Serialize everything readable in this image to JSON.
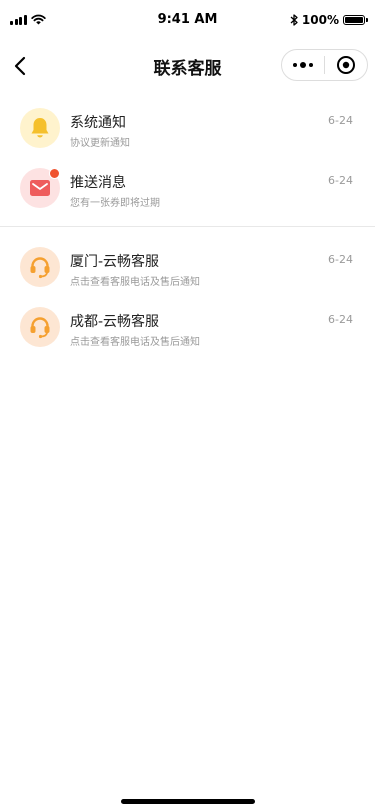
{
  "status_bar": {
    "time": "9:41 AM",
    "battery": "100%"
  },
  "nav": {
    "title": "联系客服"
  },
  "notifications": [
    {
      "title": "系统通知",
      "subtitle": "协议更新通知",
      "date": "6-24",
      "icon": "bell-icon",
      "icon_color": "#f5c02c"
    },
    {
      "title": "推送消息",
      "subtitle": "您有一张券即将过期",
      "date": "6-24",
      "icon": "mail-icon",
      "icon_color": "#ee5d5d",
      "unread": true
    }
  ],
  "services": [
    {
      "title": "厦门-云畅客服",
      "subtitle": "点击查看客服电话及售后通知",
      "date": "6-24",
      "icon": "headset-icon",
      "icon_color": "#f5a030"
    },
    {
      "title": "成都-云畅客服",
      "subtitle": "点击查看客服电话及售后通知",
      "date": "6-24",
      "icon": "headset-icon",
      "icon_color": "#f5a030"
    }
  ],
  "colors": {
    "badge": "#f0532f",
    "bell_bg": "#fff3cd",
    "mail_bg": "#fde2e2",
    "service_bg": "#fde6d3"
  }
}
